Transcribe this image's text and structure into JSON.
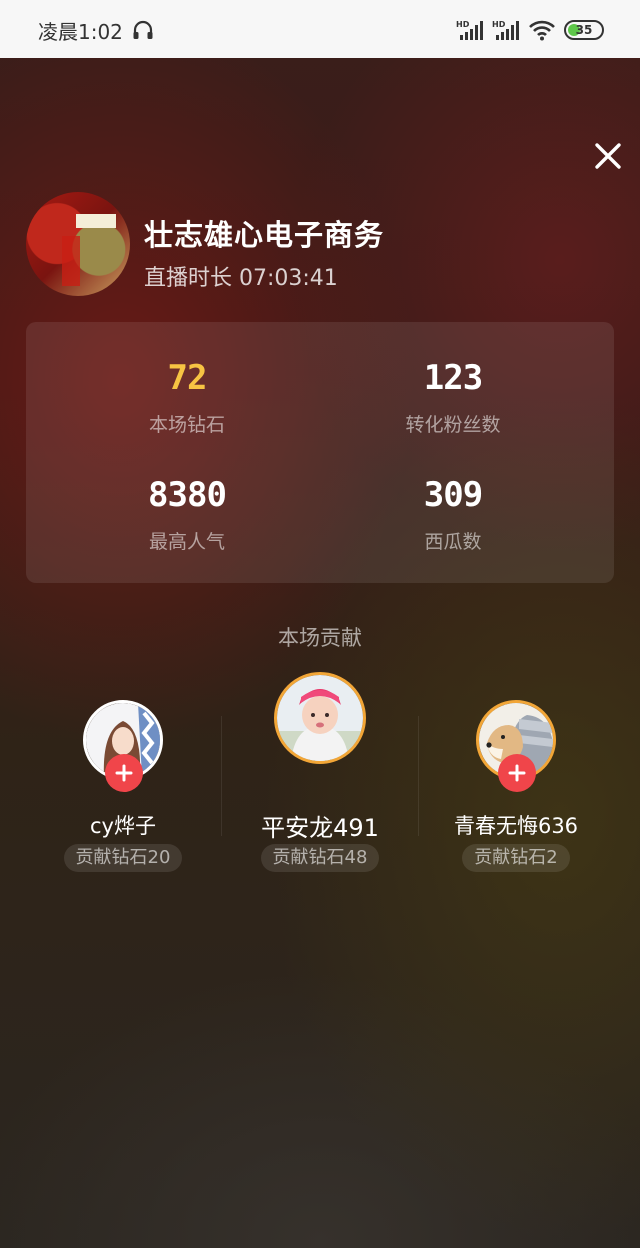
{
  "status_bar": {
    "time": "凌晨1:02",
    "battery_level": "35",
    "icons": [
      "headset-icon",
      "signal-hd-icon",
      "signal-hd-icon",
      "wifi-icon",
      "battery-icon"
    ]
  },
  "header": {
    "title": "壮志雄心电子商务",
    "duration": "直播时长 07:03:41"
  },
  "stats": [
    {
      "value": "72",
      "label": "本场钻石",
      "accent": "#f7c443"
    },
    {
      "value": "123",
      "label": "转化粉丝数"
    },
    {
      "value": "8380",
      "label": "最高人气"
    },
    {
      "value": "309",
      "label": "西瓜数"
    }
  ],
  "contributions": {
    "title": "本场贡献",
    "users": [
      {
        "name": "cy烨子",
        "badge": "贡献钻石20"
      },
      {
        "name": "平安龙491",
        "badge": "贡献钻石48"
      },
      {
        "name": "青春无悔636",
        "badge": "贡献钻石2"
      }
    ]
  },
  "colors": {
    "follow_button": "#f0454a",
    "top_ring": "#f2a637"
  }
}
